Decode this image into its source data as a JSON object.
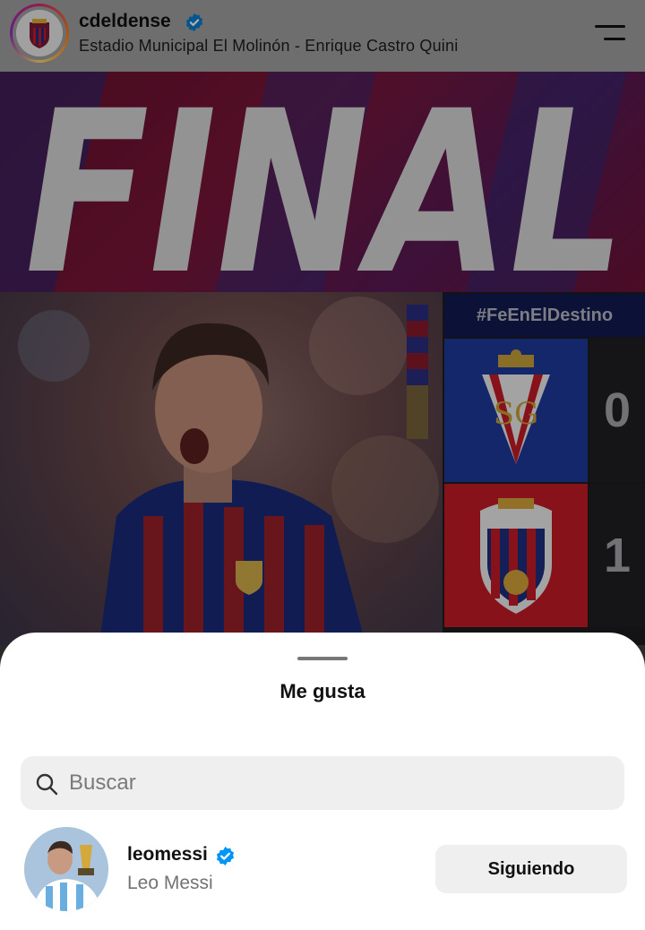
{
  "header": {
    "username": "cdeldense",
    "location": "Estadio Municipal El Molinón - Enrique Castro Quini",
    "verified_icon": "verified-badge-icon",
    "menu_icon": "hamburger-menu-icon"
  },
  "post": {
    "banner_text": "FINAL",
    "hashtag": "#FeEnElDestino",
    "teams": [
      {
        "crest": "sporting-gijon-crest",
        "score": "0"
      },
      {
        "crest": "cd-eldense-crest",
        "score": "1"
      }
    ]
  },
  "likes_sheet": {
    "title": "Me gusta",
    "search": {
      "placeholder": "Buscar",
      "value": ""
    },
    "users": [
      {
        "handle": "leomessi",
        "name": "Leo Messi",
        "verified": true,
        "button_label": "Siguiendo"
      }
    ]
  },
  "colors": {
    "banner": "#7b1638",
    "hashtag_bg": "#131b52",
    "sporting_bg": "#1d3a9c",
    "eldense_bg": "#c81b26",
    "verified_blue": "#0095f6",
    "sheet_bg": "#ffffff",
    "button_bg": "#efeff0"
  }
}
